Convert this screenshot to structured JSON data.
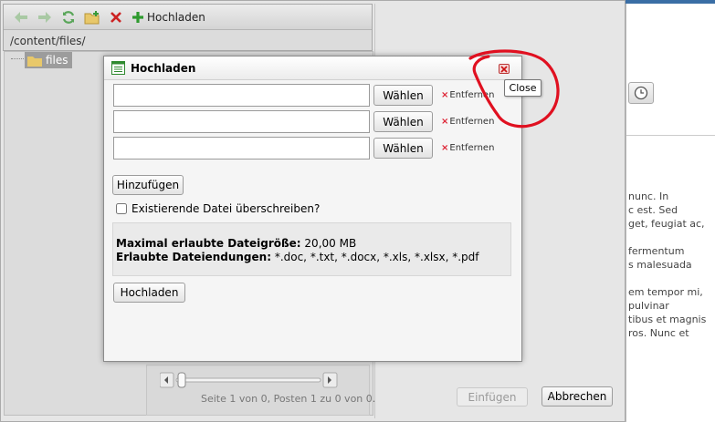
{
  "toolbar": {
    "upload_label": "Hochladen"
  },
  "path": "/content/files/",
  "tree": {
    "root_label": "files"
  },
  "pager": {
    "text": "Seite 1 von 0, Posten 1 zu 0 von 0."
  },
  "footer": {
    "insert_label": "Einfügen",
    "cancel_label": "Abbrechen"
  },
  "dialog": {
    "title": "Hochladen",
    "close_tooltip": "Close",
    "rows": [
      {
        "choose_label": "Wählen",
        "remove_label": "Entfernen",
        "value": ""
      },
      {
        "choose_label": "Wählen",
        "remove_label": "Entfernen",
        "value": ""
      },
      {
        "choose_label": "Wählen",
        "remove_label": "Entfernen",
        "value": ""
      }
    ],
    "add_label": "Hinzufügen",
    "overwrite_label": "Existierende Datei überschreiben?",
    "max_size_label": "Maximal erlaubte Dateigröße:",
    "max_size_value": " 20,00 MB",
    "allowed_ext_label": "Erlaubte Dateiendungen:",
    "allowed_ext_value": " *.doc, *.txt, *.docx, *.xls, *.xlsx, *.pdf",
    "upload_label": "Hochladen"
  },
  "background_text": "nunc. In\nc est. Sed\nget, feugiat ac,\n\nfermentum\ns malesuada\n\nem tempor mi,\npulvinar\ntibus et magnis\nros. Nunc et",
  "colors": {
    "accent_red": "#e01020",
    "add_green": "#2e9a2e",
    "delete_red": "#cc2222"
  }
}
